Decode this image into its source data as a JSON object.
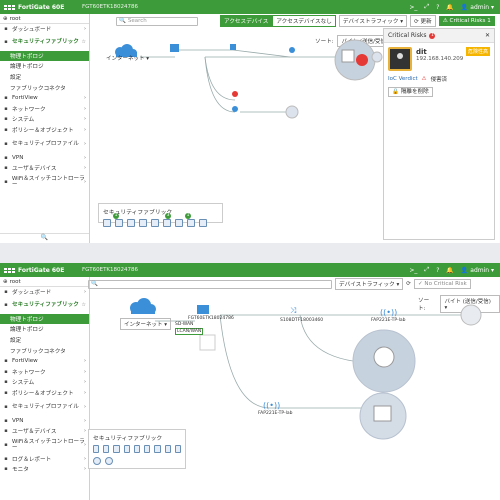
{
  "app": {
    "brand": "FortiGate 60E",
    "serial": "FGT60ETK18024786",
    "user": "admin"
  },
  "top": {
    "search_placeholder": "Search",
    "tab_active": "アクセスデバイス",
    "tab_inactive": "アクセスデバイスなし",
    "traffic_menu": "デバイストラフィック",
    "refresh": "更新",
    "critical_risks": "Critical Risks",
    "critical_risks_count": "1",
    "sort_label": "ソート:",
    "sort_value": "バイト (送信/受信)",
    "internet": "インターネット",
    "fabric_title": "セキュリティファブリック",
    "fabric_badges": [
      "1",
      "3",
      "1"
    ],
    "risk_panel": {
      "title": "Critical Risks",
      "count": "1",
      "device_name": "dit",
      "device_ip": "192.168.140.209",
      "tag": "危険性高",
      "ioc_label": "IoC Verdict",
      "ioc_value": "侵害済",
      "action": "隔離を削除"
    }
  },
  "bottom": {
    "search_placeholder": "",
    "traffic_menu": "デバイストラフィック",
    "no_critical": "No Critical Risk",
    "sort_label": "ソート:",
    "sort_value": "バイト (送信/受信)",
    "internet": "インターネット",
    "fgt_label": "FGT60ETK18024786",
    "wan": "SD-WAN",
    "wan2": "LCAN/WAN",
    "switch_label": "S108DTF18003460",
    "ap1": "FAP221E-TP-lab",
    "ap2": "FAP221E-TP-lab",
    "fabric_title": "セキュリティファブリック"
  },
  "sidebar": {
    "vdom": "root",
    "items": [
      {
        "label": "ダッシュボード",
        "icon": "dashboard-icon",
        "arrow": true
      },
      {
        "label": "セキュリティファブリック",
        "icon": "fabric-icon",
        "section": true
      },
      {
        "label": "物理トポロジ",
        "sub": true,
        "active": true
      },
      {
        "label": "論理トポロジ",
        "sub": true
      },
      {
        "label": "設定",
        "sub": true
      },
      {
        "label": "ファブリックコネクタ",
        "sub": true
      },
      {
        "label": "FortiView",
        "icon": "chart-icon",
        "arrow": true
      },
      {
        "label": "ネットワーク",
        "icon": "network-icon",
        "arrow": true
      },
      {
        "label": "システム",
        "icon": "gear-icon",
        "arrow": true
      },
      {
        "label": "ポリシー＆オブジェクト",
        "icon": "policy-icon",
        "arrow": true
      },
      {
        "label": "セキュリティプロファイル",
        "icon": "lock-icon",
        "arrow": true,
        "tall": true
      },
      {
        "label": "VPN",
        "icon": "monitor-icon",
        "arrow": true
      },
      {
        "label": "ユーザ＆デバイス",
        "icon": "user-icon",
        "arrow": true
      },
      {
        "label": "WiFi＆スイッチコントローラー",
        "icon": "wifi-icon",
        "arrow": true,
        "tall": true
      }
    ],
    "items2_extra": [
      {
        "label": "ログ＆レポート",
        "icon": "log-icon",
        "arrow": true
      },
      {
        "label": "モニタ",
        "icon": "monitor2-icon",
        "arrow": true
      }
    ]
  },
  "colors": {
    "brand_green": "#3e9b3a",
    "node_blue": "#3b8fd9",
    "alert_red": "#e53935"
  }
}
